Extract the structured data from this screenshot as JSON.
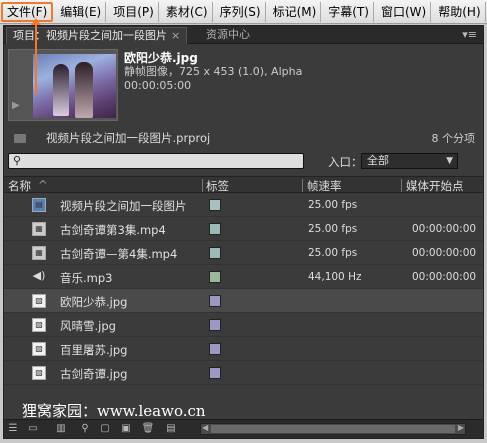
{
  "menu": [
    "文件(F)",
    "编辑(E)",
    "项目(P)",
    "素材(C)",
    "序列(S)",
    "标记(M)",
    "字幕(T)",
    "窗口(W)",
    "帮助(H)"
  ],
  "tabs": {
    "project": "项目：视频片段之间加一段图片",
    "project_close": "×",
    "resources": "资源中心",
    "panel_menu": "▾≡"
  },
  "preview": {
    "name": "欧阳少恭.jpg",
    "info": "静帧图像，725 x 453 (1.0), Alpha",
    "duration": "00:00:05:00"
  },
  "project": {
    "file_name": "视频片段之间加一段图片.prproj",
    "item_count": "8 个分项"
  },
  "search": {
    "placeholder": ""
  },
  "entry": {
    "label": "入口：",
    "value": "全部"
  },
  "columns": [
    "名称",
    "标签",
    "帧速率",
    "媒体开始点"
  ],
  "rows": [
    {
      "name": "视频片段之间加一段图片",
      "icon": "sequence",
      "label_color": "#a7c1c3",
      "rate": "25.00 fps",
      "start": ""
    },
    {
      "name": "古剑奇谭第3集.mp4",
      "icon": "video",
      "label_color": "#9bb9b6",
      "rate": "25.00 fps",
      "start": "00:00:00:00"
    },
    {
      "name": "古剑奇谭—第4集.mp4",
      "icon": "video",
      "label_color": "#9bb9b6",
      "rate": "25.00 fps",
      "start": "00:00:00:00"
    },
    {
      "name": "音乐.mp3",
      "icon": "audio",
      "label_color": "#98b899",
      "rate": "44,100 Hz",
      "start": "00:00:00:00"
    },
    {
      "name": "欧阳少恭.jpg",
      "icon": "image",
      "label_color": "#9c98c4",
      "rate": "",
      "start": ""
    },
    {
      "name": "风晴雪.jpg",
      "icon": "image",
      "label_color": "#9c98c4",
      "rate": "",
      "start": ""
    },
    {
      "name": "百里屠苏.jpg",
      "icon": "image",
      "label_color": "#9c98c4",
      "rate": "",
      "start": ""
    },
    {
      "name": "古剑奇谭.jpg",
      "icon": "image",
      "label_color": "#9c98c4",
      "rate": "",
      "start": ""
    }
  ],
  "watermark": "狸窝家园：www.leawo.cn",
  "colors": {
    "accent": "#f07a2c",
    "panel": "#3b3b3b"
  }
}
